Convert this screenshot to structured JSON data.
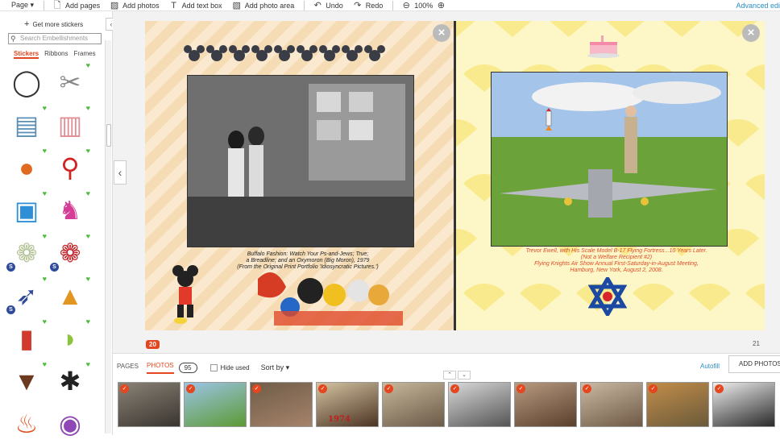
{
  "toolbar": {
    "page_menu": "Page ▾",
    "add_pages": "Add pages",
    "add_photos": "Add photos",
    "add_text_box": "Add text box",
    "add_photo_area": "Add photo area",
    "undo": "Undo",
    "redo": "Redo",
    "zoom": "100%",
    "advanced_editor": "Advanced edi"
  },
  "sidebar": {
    "get_more": "Get more stickers",
    "search_placeholder": "Search Embellishments",
    "tabs": [
      "Stickers",
      "Ribbons",
      "Frames"
    ],
    "stickers": [
      {
        "icon": "bicycle-wheel-icon",
        "glyph": "◯",
        "color": "#333",
        "heart": false,
        "s": false
      },
      {
        "icon": "bobby-pins-icon",
        "glyph": "✂",
        "color": "#888",
        "heart": true,
        "s": false
      },
      {
        "icon": "suitcases-icon",
        "glyph": "▤",
        "color": "#5a8fb3",
        "heart": true,
        "s": false
      },
      {
        "icon": "luggage-icon",
        "glyph": "▥",
        "color": "#e08c94",
        "heart": true,
        "s": false
      },
      {
        "icon": "globe-icon",
        "glyph": "●",
        "color": "#e06a1f",
        "heart": true,
        "s": false
      },
      {
        "icon": "bicycle-icon",
        "glyph": "⚲",
        "color": "#d02424",
        "heart": true,
        "s": false
      },
      {
        "icon": "robot-icon",
        "glyph": "▣",
        "color": "#2e8fd6",
        "heart": true,
        "s": false
      },
      {
        "icon": "rabbit-icon",
        "glyph": "♞",
        "color": "#d63d97",
        "heart": true,
        "s": false
      },
      {
        "icon": "lace-elephant-icon",
        "glyph": "❁",
        "color": "#b6c49a",
        "heart": true,
        "s": true
      },
      {
        "icon": "lace-elephant-red-icon",
        "glyph": "❁",
        "color": "#c2262c",
        "heart": true,
        "s": true
      },
      {
        "icon": "swordfish-icon",
        "glyph": "➶",
        "color": "#2f4a9b",
        "heart": true,
        "s": true
      },
      {
        "icon": "pizza-slice-icon",
        "glyph": "▲",
        "color": "#e2951f",
        "heart": true,
        "s": false
      },
      {
        "icon": "thermometer-icon",
        "glyph": "▮",
        "color": "#d13a2c",
        "heart": true,
        "s": false
      },
      {
        "icon": "lime-slice-icon",
        "glyph": "◗",
        "color": "#8cc43d",
        "heart": true,
        "s": false
      },
      {
        "icon": "ice-cream-cone-icon",
        "glyph": "▼",
        "color": "#6b3a1f",
        "heart": true,
        "s": false
      },
      {
        "icon": "beetle-icon",
        "glyph": "✱",
        "color": "#222",
        "heart": true,
        "s": false
      },
      {
        "icon": "fire-icon",
        "glyph": "♨",
        "color": "#e54a1a",
        "heart": false,
        "s": false
      },
      {
        "icon": "donut-icon",
        "glyph": "◉",
        "color": "#8d48b5",
        "heart": false,
        "s": false
      }
    ]
  },
  "spread": {
    "left_caption": "Buffalo Fashion: Watch Your Ps-and-Jews; True;\na Breadline; and an Oxymoron (Big Moron), 1979\n(From the Original Print Portfolio 'Idiosyncratic Pictures.')",
    "right_caption": "Trevor Ewell, with His Scale Model B-17 Flying Fortress...10 Years Later.\n(Not a Welfare Recipient #2)\nFlying Knights Air Show Annual First-Saturday-in-August Meeting,\nHamburg, New York, August 2, 2008.",
    "left_page_number": "20",
    "right_page_number": "21",
    "close_symbol": "×"
  },
  "bottom": {
    "tab_pages": "PAGES",
    "tab_photos": "PHOTOS",
    "photo_count": "95",
    "hide_used": "Hide used",
    "sort_by": "Sort by ▾",
    "autofill": "Autofill",
    "add_photos": "ADD PHOTOS",
    "thumb_year": "1974",
    "thumbnails": [
      {
        "name": "thumb-1",
        "colors": [
          "#8a8276",
          "#3a3530"
        ]
      },
      {
        "name": "thumb-2",
        "colors": [
          "#9cc4e6",
          "#5c9a34"
        ]
      },
      {
        "name": "thumb-3",
        "colors": [
          "#6f5d48",
          "#a6826a"
        ]
      },
      {
        "name": "thumb-4",
        "colors": [
          "#d4c3a1",
          "#4c3424"
        ]
      },
      {
        "name": "thumb-5",
        "colors": [
          "#c7b79a",
          "#6a5a48"
        ]
      },
      {
        "name": "thumb-6",
        "colors": [
          "#d9d9d9",
          "#555"
        ]
      },
      {
        "name": "thumb-7",
        "colors": [
          "#b89a80",
          "#5a3f2c"
        ]
      },
      {
        "name": "thumb-8",
        "colors": [
          "#cbb9a3",
          "#6e5a44"
        ]
      },
      {
        "name": "thumb-9",
        "colors": [
          "#c28d4a",
          "#6a5a3a"
        ]
      },
      {
        "name": "thumb-10",
        "colors": [
          "#eeeeee",
          "#2a2a2a"
        ]
      }
    ]
  }
}
